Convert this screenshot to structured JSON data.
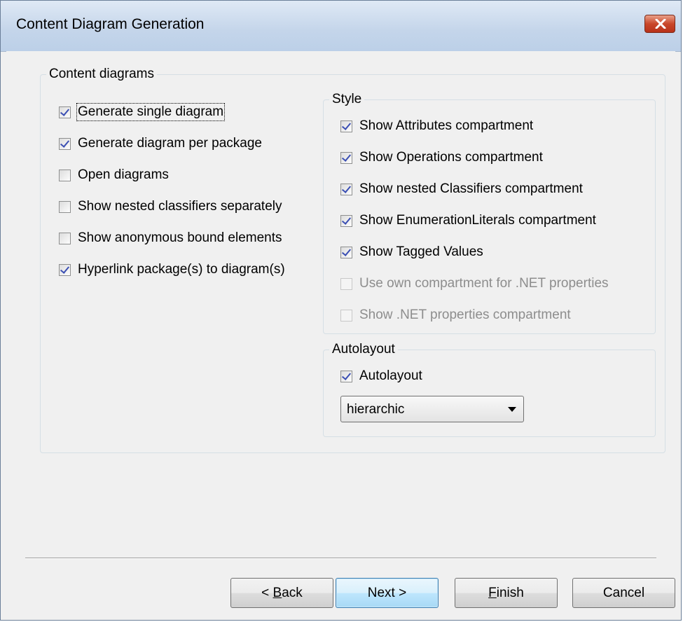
{
  "window": {
    "title": "Content Diagram Generation",
    "close_icon": "close-icon"
  },
  "content_group": {
    "legend": "Content diagrams",
    "options": [
      {
        "label": "Generate single diagram",
        "checked": true,
        "enabled": true
      },
      {
        "label": "Generate diagram per package",
        "checked": true,
        "enabled": true
      },
      {
        "label": "Open diagrams",
        "checked": false,
        "enabled": true
      },
      {
        "label": "Show nested classifiers separately",
        "checked": false,
        "enabled": true
      },
      {
        "label": "Show anonymous bound elements",
        "checked": false,
        "enabled": true
      },
      {
        "label": "Hyperlink package(s) to diagram(s)",
        "checked": true,
        "enabled": true
      }
    ]
  },
  "style_group": {
    "legend": "Style",
    "options": [
      {
        "label": "Show Attributes compartment",
        "checked": true,
        "enabled": true
      },
      {
        "label": "Show Operations compartment",
        "checked": true,
        "enabled": true
      },
      {
        "label": "Show nested Classifiers compartment",
        "checked": true,
        "enabled": true
      },
      {
        "label": "Show EnumerationLiterals compartment",
        "checked": true,
        "enabled": true
      },
      {
        "label": "Show Tagged Values",
        "checked": true,
        "enabled": true
      },
      {
        "label": "Use own compartment for .NET properties",
        "checked": false,
        "enabled": false
      },
      {
        "label": "Show .NET properties compartment",
        "checked": false,
        "enabled": false
      }
    ]
  },
  "autolayout_group": {
    "legend": "Autolayout",
    "checkbox_label": "Autolayout",
    "checked": true,
    "select_value": "hierarchic"
  },
  "buttons": {
    "back": {
      "pre": "< ",
      "mnemonic": "B",
      "post": "ack"
    },
    "next": "Next >",
    "finish": {
      "mnemonic": "F",
      "post": "inish"
    },
    "cancel": "Cancel"
  }
}
